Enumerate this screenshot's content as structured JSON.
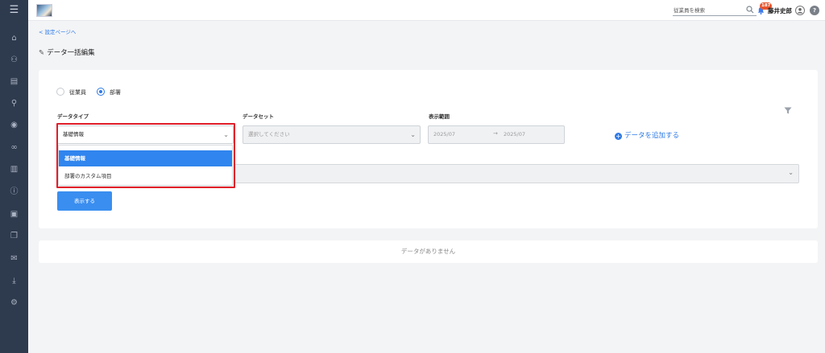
{
  "sidebar": {
    "menu_icon": "☰",
    "items": [
      {
        "name": "home-icon",
        "glyph": "⌂"
      },
      {
        "name": "org-chart-icon",
        "glyph": "⚇"
      },
      {
        "name": "document-icon",
        "glyph": "▤"
      },
      {
        "name": "search-icon",
        "glyph": "⚲"
      },
      {
        "name": "chat-icon",
        "glyph": "◉"
      },
      {
        "name": "link-icon",
        "glyph": "∞"
      },
      {
        "name": "bar-chart-icon",
        "glyph": "▥"
      },
      {
        "name": "info-icon",
        "glyph": "ⓘ"
      },
      {
        "name": "contacts-icon",
        "glyph": "▣"
      },
      {
        "name": "book-icon",
        "glyph": "❐"
      },
      {
        "name": "mail-icon",
        "glyph": "✉"
      },
      {
        "name": "download-icon",
        "glyph": "⤓"
      },
      {
        "name": "user-settings-icon",
        "glyph": "⚙"
      }
    ]
  },
  "header": {
    "search_placeholder": "従業員を検索",
    "notification_count": "187",
    "username": "藤井史郎",
    "help_glyph": "?"
  },
  "breadcrumb": {
    "back_link": "< 設定ページへ"
  },
  "page": {
    "title": "データ一括編集",
    "title_icon": "✎"
  },
  "filters": {
    "target_options": [
      {
        "label": "従業員",
        "selected": false
      },
      {
        "label": "部署",
        "selected": true
      }
    ],
    "data_type": {
      "label": "データタイプ",
      "value": "基礎情報"
    },
    "data_set": {
      "label": "データセット",
      "placeholder": "選択してください"
    },
    "display_range": {
      "label": "表示範囲",
      "from": "2025/07",
      "arrow": "→",
      "to": "2025/07"
    },
    "add_data_label": "データを追加する",
    "show_button": "表示する"
  },
  "dropdown": {
    "options": [
      {
        "label": "基礎情報",
        "active": true
      },
      {
        "label": "部署のカスタム項目",
        "active": false
      }
    ]
  },
  "results": {
    "empty_message": "データがありません"
  },
  "colors": {
    "accent": "#2f7be6",
    "sidebar": "#2e3a4e",
    "highlight": "#e01e2a",
    "badge": "#e8552f"
  }
}
